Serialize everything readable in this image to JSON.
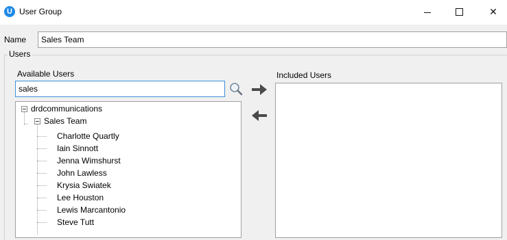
{
  "window": {
    "title": "User Group",
    "app_icon_letter": "U",
    "buttons": {
      "minimize_icon": "minimize-icon",
      "maximize_icon": "maximize-icon",
      "close_label": "✕"
    }
  },
  "form": {
    "name_label": "Name",
    "name_value": "Sales Team",
    "users_group_label": "Users"
  },
  "available": {
    "label": "Available Users",
    "search_value": "sales",
    "search_icon": "magnifier-icon"
  },
  "included": {
    "label": "Included Users"
  },
  "transfer": {
    "add_icon": "arrow-right-icon",
    "remove_icon": "arrow-left-icon"
  },
  "tree": {
    "root": "drdcommunications",
    "group": "Sales Team",
    "members": [
      "Charlotte Quartly",
      "Iain Sinnott",
      "Jenna Wimshurst",
      "John Lawless",
      "Krysia Swiatek",
      "Lee Houston",
      "Lewis Marcantonio",
      "Steve Tutt"
    ]
  }
}
